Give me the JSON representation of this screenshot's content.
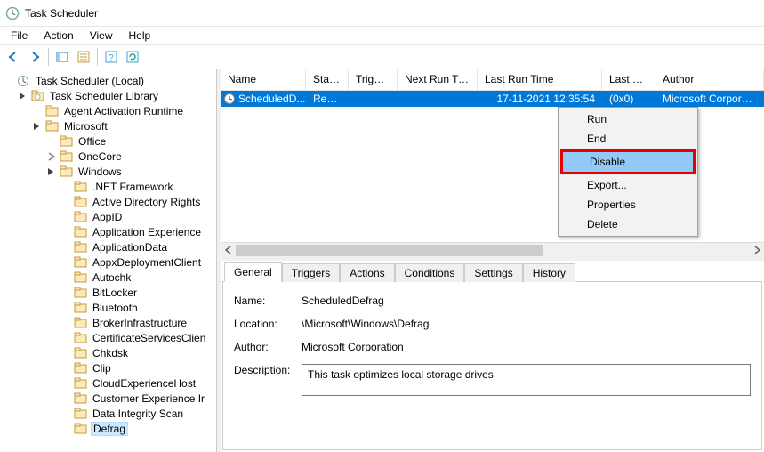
{
  "app": {
    "title": "Task Scheduler"
  },
  "menubar": {
    "file": "File",
    "action": "Action",
    "view": "View",
    "help": "Help"
  },
  "tree": {
    "root": "Task Scheduler (Local)",
    "library": "Task Scheduler Library",
    "agent": "Agent Activation Runtime",
    "microsoft": "Microsoft",
    "office": "Office",
    "onecore": "OneCore",
    "windows": "Windows",
    "items": {
      "net": ".NET Framework",
      "adrights": "Active Directory Rights",
      "appid": "AppID",
      "appexp": "Application Experience",
      "appdata": "ApplicationData",
      "appx": "AppxDeploymentClient",
      "autochk": "Autochk",
      "bitlocker": "BitLocker",
      "bluetooth": "Bluetooth",
      "broker": "BrokerInfrastructure",
      "cert": "CertificateServicesClien",
      "chkdsk": "Chkdsk",
      "clip": "Clip",
      "cloud": "CloudExperienceHost",
      "custexp": "Customer Experience Ir",
      "datascan": "Data Integrity Scan",
      "defrag": "Defrag"
    }
  },
  "columns": {
    "name": "Name",
    "status": "Status",
    "triggers": "Triggers",
    "nextrun": "Next Run Time",
    "lastrun": "Last Run Time",
    "lastresult": "Last Run Result",
    "author": "Author"
  },
  "task_rows": [
    {
      "name": "ScheduledD...",
      "status": "Ready",
      "triggers": "",
      "nextrun": "",
      "lastrun": "17-11-2021 12:35:54",
      "lastresult": "(0x0)",
      "author": "Microsoft Corporatio"
    }
  ],
  "ctx": {
    "run": "Run",
    "end": "End",
    "disable": "Disable",
    "export": "Export...",
    "properties": "Properties",
    "delete": "Delete"
  },
  "tabs": {
    "general": "General",
    "triggers": "Triggers",
    "actions": "Actions",
    "conditions": "Conditions",
    "settings": "Settings",
    "history": "History"
  },
  "details": {
    "name_lbl": "Name:",
    "name_val": "ScheduledDefrag",
    "loc_lbl": "Location:",
    "loc_val": "\\Microsoft\\Windows\\Defrag",
    "author_lbl": "Author:",
    "author_val": "Microsoft Corporation",
    "desc_lbl": "Description:",
    "desc_val": "This task optimizes local storage drives."
  }
}
